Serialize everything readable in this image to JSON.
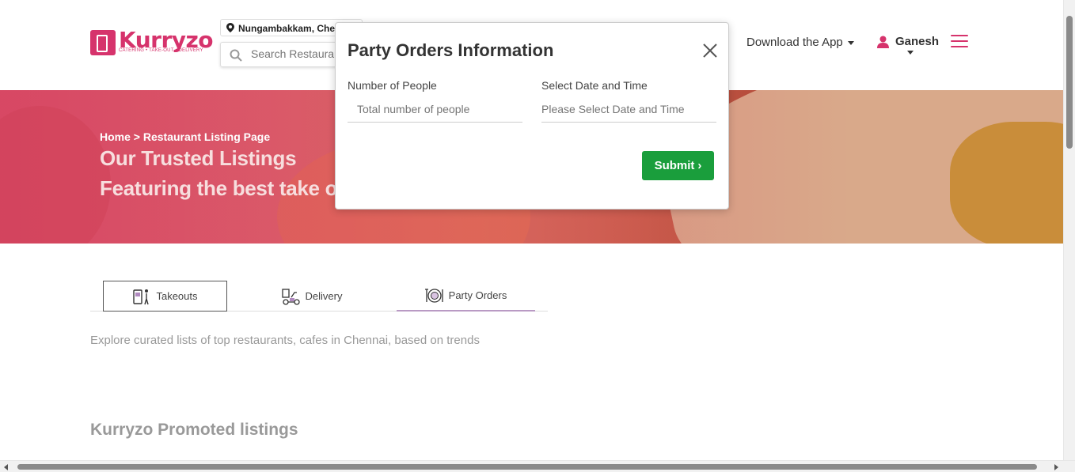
{
  "brand": {
    "name": "Kurryzo",
    "tagline": "CATERING • TAKE-OUT • DELIVERY",
    "color": "#d6336c"
  },
  "header": {
    "location": "Nungambakkam, Chennai",
    "search_placeholder": "Search Restaurants",
    "download_label": "Download the App",
    "user_name": "Ganesh"
  },
  "banner": {
    "breadcrumb": "Home > Restaurant Listing Page",
    "title_line1": "Our Trusted Listings",
    "title_line2": "Featuring the best take outs"
  },
  "tabs": [
    {
      "label": "Takeouts",
      "icon": "takeout-icon"
    },
    {
      "label": "Delivery",
      "icon": "delivery-icon"
    },
    {
      "label": "Party Orders",
      "icon": "party-orders-icon"
    }
  ],
  "explore_text": "Explore curated lists of top restaurants, cafes in Chennai, based on trends",
  "promoted_title": "Kurryzo Promoted listings",
  "modal": {
    "title": "Party Orders Information",
    "people_label": "Number of People",
    "people_placeholder": "Total number of people",
    "date_label": "Select Date and Time",
    "date_placeholder": "Please Select Date and Time",
    "submit_label": "Submit",
    "submit_color": "#1a9e3c"
  }
}
